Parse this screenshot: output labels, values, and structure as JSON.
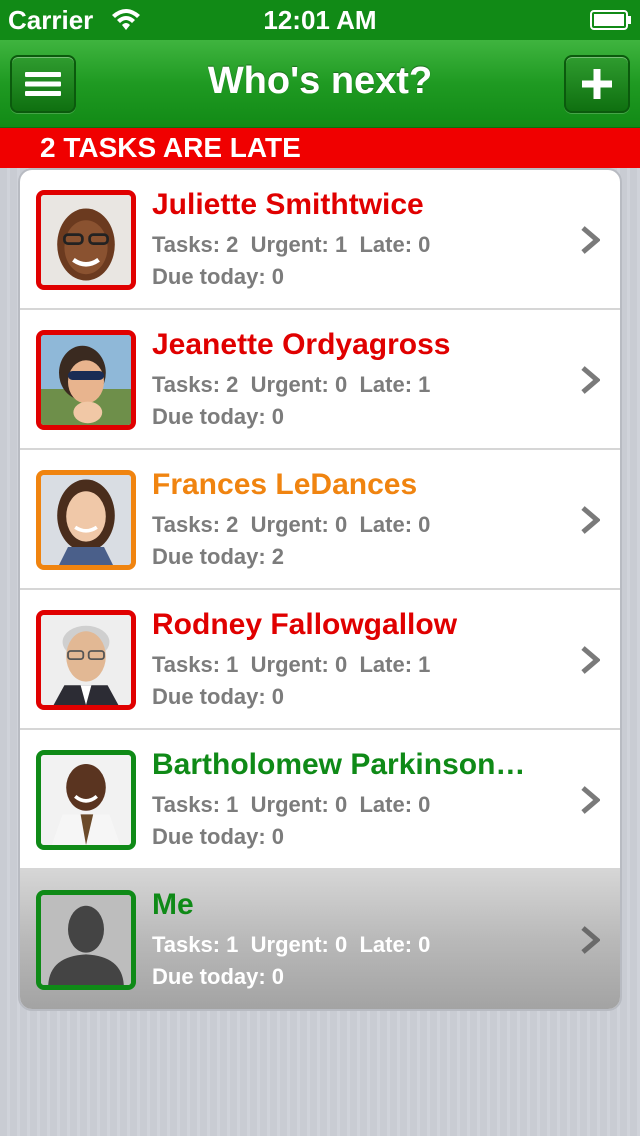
{
  "status_bar": {
    "carrier": "Carrier",
    "time": "12:01 AM"
  },
  "nav": {
    "title": "Who's next?",
    "menu_icon": "hamburger-icon",
    "add_icon": "plus-icon"
  },
  "banner": {
    "text": "2 TASKS ARE LATE",
    "color": "#f00000"
  },
  "people": [
    {
      "name": "Juliette Smithtwice",
      "tasks": "Tasks: 2",
      "urgent": "Urgent: 1",
      "late": "Late: 0",
      "due": "Due today: 0",
      "color": "#e00000"
    },
    {
      "name": "Jeanette Ordyagross",
      "tasks": "Tasks: 2",
      "urgent": "Urgent: 0",
      "late": "Late: 1",
      "due": "Due today: 0",
      "color": "#e00000"
    },
    {
      "name": "Frances LeDances",
      "tasks": "Tasks: 2",
      "urgent": "Urgent: 0",
      "late": "Late: 0",
      "due": "Due today: 2",
      "color": "#f08410"
    },
    {
      "name": "Rodney Fallowgallow",
      "tasks": "Tasks: 1",
      "urgent": "Urgent: 0",
      "late": "Late: 1",
      "due": "Due today: 0",
      "color": "#e00000"
    },
    {
      "name": "Bartholomew Parkinson…",
      "tasks": "Tasks: 1",
      "urgent": "Urgent: 0",
      "late": "Late: 0",
      "due": "Due today: 0",
      "color": "#0f8a17"
    },
    {
      "name": "Me",
      "tasks": "Tasks: 1",
      "urgent": "Urgent: 0",
      "late": "Late: 0",
      "due": "Due today: 0",
      "color": "#0f8a17"
    }
  ],
  "colors": {
    "nav_green": "#1f9a22",
    "late_red": "#e00000",
    "due_orange": "#f08410",
    "ok_green": "#0f8a17"
  }
}
